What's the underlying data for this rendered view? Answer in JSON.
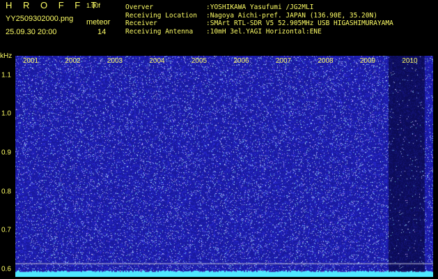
{
  "header": {
    "brand": "H R O F F T",
    "version": "1.00f",
    "filename": "YY2509302000.png",
    "timestamp": "25.09.30 20:00",
    "meteor_label": "meteor",
    "meteor_count": "14"
  },
  "info": [
    {
      "key": "Overver",
      "value": ":YOSHIKAWA Yasufumi /JG2MLI"
    },
    {
      "key": "Receiving Location",
      "value": ":Nagoya Aichi-pref. JAPAN (136.90E, 35.20N)"
    },
    {
      "key": "Receiver",
      "value": ":SMArt RTL-SDR V5 52.905MHz USB HIGASHIMURAYAMA"
    },
    {
      "key": "Receiving Antenna",
      "value": ":10mH 3el.YAGI Horizontal:ENE"
    }
  ],
  "chart_data": {
    "type": "heatmap",
    "unit_label": "kHz",
    "y_ticks": [
      "1.1",
      "1.0",
      "0.9",
      "0.8",
      "0.7",
      "0.6"
    ],
    "x_ticks": [
      "2001",
      "2002",
      "2003",
      "2004",
      "2005",
      "2006",
      "2007",
      "2008",
      "2009",
      "2010"
    ],
    "ylim": [
      0.58,
      1.15
    ],
    "colors": {
      "background": "#1a1aa0",
      "dark_band": "#0c0c58",
      "noise_light": "#8fb8ff",
      "bottom_band": "#4ee8ff",
      "line": "#c8c8d8"
    }
  }
}
